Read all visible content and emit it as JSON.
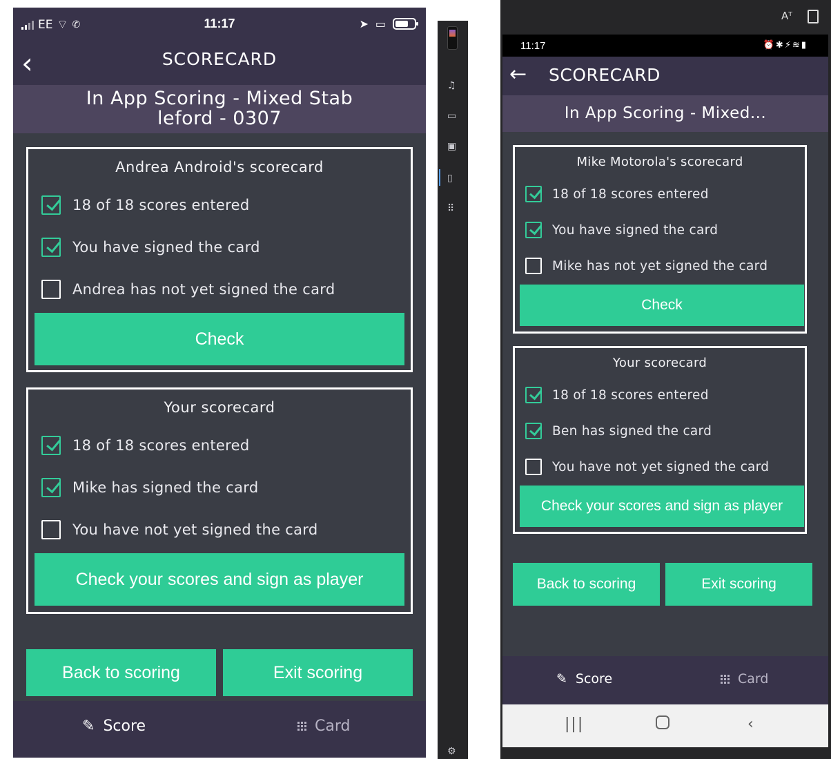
{
  "ios": {
    "status": {
      "carrier": "EE",
      "time": "11:17"
    },
    "header": {
      "back_glyph": "‹",
      "title": "SCORECARD"
    },
    "subtitle_line1": "In App Scoring - Mixed Stab",
    "subtitle_line2": "leford - 0307",
    "opponent_card": {
      "title": "Andrea Android's scorecard",
      "rows": [
        {
          "text": "18 of 18 scores entered",
          "checked": true
        },
        {
          "text": "You have signed the card",
          "checked": true
        },
        {
          "text": "Andrea has not yet signed the card",
          "checked": false
        }
      ],
      "button": "Check"
    },
    "your_card": {
      "title": "Your scorecard",
      "rows": [
        {
          "text": "18 of 18 scores entered",
          "checked": true
        },
        {
          "text": "Mike has signed the card",
          "checked": true
        },
        {
          "text": "You have not yet signed the card",
          "checked": false
        }
      ],
      "button": "Check your scores and sign as player"
    },
    "actions": {
      "back": "Back to scoring",
      "exit": "Exit scoring"
    },
    "tabs": {
      "score": "Score",
      "card": "Card"
    }
  },
  "android": {
    "status": {
      "time": "11:17"
    },
    "header": {
      "title": "SCORECARD"
    },
    "subtitle": "In App Scoring - Mixed...",
    "opponent_card": {
      "title": "Mike Motorola's scorecard",
      "rows": [
        {
          "text": "18 of 18 scores entered",
          "checked": true
        },
        {
          "text": "You have signed the card",
          "checked": true
        },
        {
          "text": "Mike has not yet signed the card",
          "checked": false
        }
      ],
      "button": "Check"
    },
    "your_card": {
      "title": "Your scorecard",
      "rows": [
        {
          "text": "18 of 18 scores entered",
          "checked": true
        },
        {
          "text": "Ben has signed the card",
          "checked": true
        },
        {
          "text": "You have not yet signed the card",
          "checked": false
        }
      ],
      "button": "Check your scores and sign as player"
    },
    "actions": {
      "back": "Back to scoring",
      "exit": "Exit scoring"
    },
    "tabs": {
      "score": "Score",
      "card": "Card"
    }
  },
  "colors": {
    "accent": "#2fcc96",
    "check": "#33cc99",
    "header_bg": "#38334a",
    "subtitle_bg": "#4d455e",
    "body_bg": "#3a3d45"
  },
  "icons": [
    "back-chevron-icon",
    "pencil-icon",
    "grid-icon",
    "checkbox-checked-icon",
    "checkbox-empty-icon",
    "back-arrow-icon"
  ]
}
